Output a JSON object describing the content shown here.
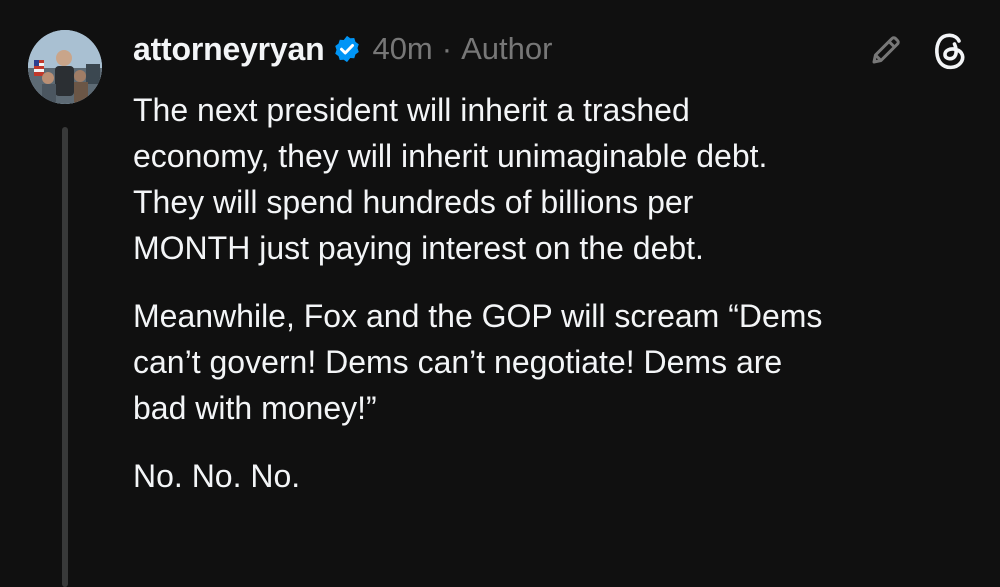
{
  "post": {
    "username": "attorneyryan",
    "verified_icon": "verified-badge-icon",
    "timestamp": "40m",
    "separator": "·",
    "role_label": "Author",
    "actions": {
      "edit_icon": "pencil-icon",
      "app_icon": "threads-logo-icon"
    },
    "paragraphs": [
      "The next president will inherit a trashed\neconomy, they will inherit unimaginable debt.\nThey will spend hundreds of billions per\nMONTH just paying interest on the debt.",
      "Meanwhile, Fox and the GOP will scream “Dems\ncan’t govern! Dems can’t negotiate! Dems are\nbad with money!”",
      "No. No. No."
    ]
  },
  "colors": {
    "background": "#101010",
    "text_primary": "#f3f5f7",
    "text_secondary": "#777777",
    "verified_blue": "#0095f6",
    "thread_line": "#383939"
  }
}
